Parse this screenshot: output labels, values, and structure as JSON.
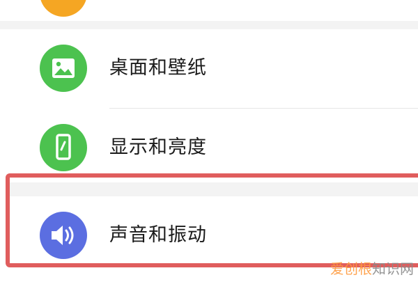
{
  "settings": {
    "items": [
      {
        "label": "桌面和壁纸",
        "icon": "image-icon",
        "icon_color": "#4cc24f"
      },
      {
        "label": "显示和亮度",
        "icon": "phone-display-icon",
        "icon_color": "#4cc24f"
      },
      {
        "label": "声音和振动",
        "icon": "speaker-icon",
        "icon_color": "#5b6ee1"
      }
    ],
    "top_partial_icon_color": "#f5a623",
    "highlight_color": "#e05d5d"
  },
  "watermark": {
    "brand": "爱创根",
    "suffix": "知识网"
  }
}
